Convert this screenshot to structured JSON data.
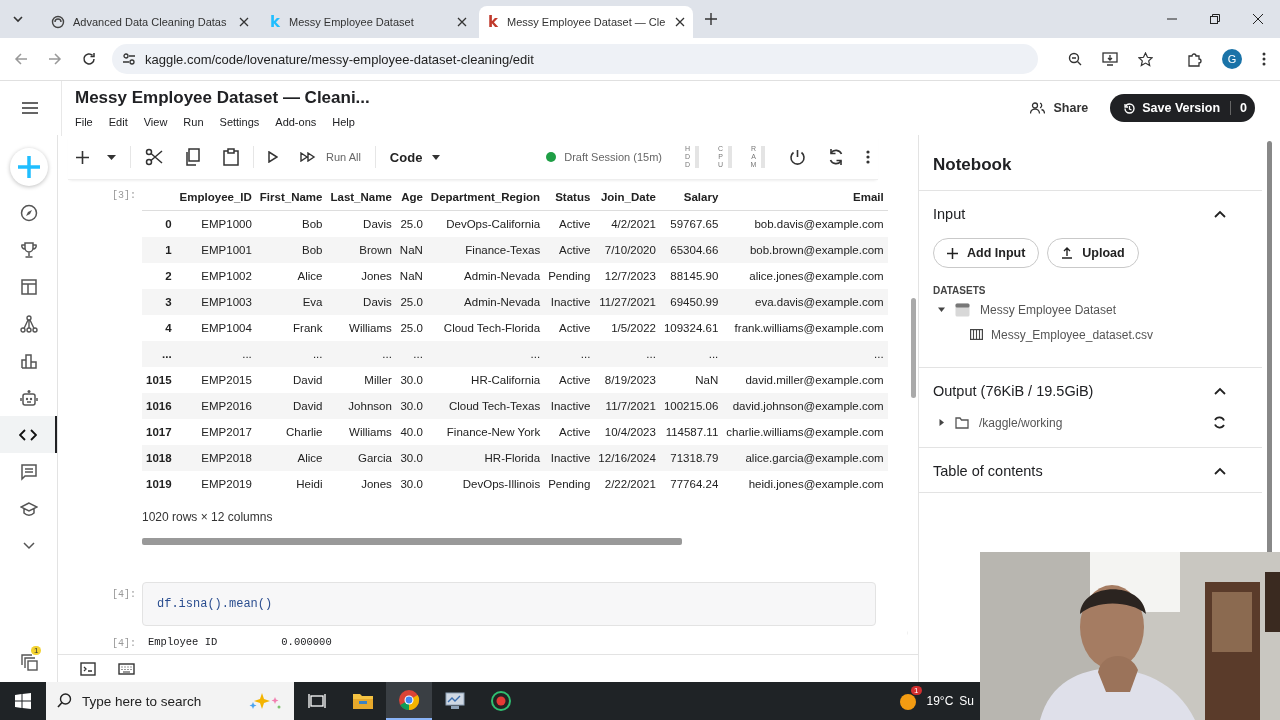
{
  "browser": {
    "tabs": [
      {
        "title": "Advanced Data Cleaning Datas",
        "selected": false
      },
      {
        "title": "Messy Employee Dataset",
        "favicon": "k",
        "selected": false
      },
      {
        "title": "Messy Employee Dataset — Cle",
        "favicon": "k",
        "selected": true
      }
    ],
    "url": "kaggle.com/code/lovenature/messy-employee-dataset-cleaning/edit",
    "profile": "G"
  },
  "kaggle": {
    "title": "Messy Employee Dataset — Cleani...",
    "menu": [
      "File",
      "Edit",
      "View",
      "Run",
      "Settings",
      "Add-ons",
      "Help"
    ],
    "share": "Share",
    "save_version": "Save Version",
    "save_count": "0"
  },
  "rail": [
    {
      "kind": "create",
      "selected": false
    },
    {
      "kind": "compass",
      "selected": false
    },
    {
      "kind": "trophy",
      "selected": false
    },
    {
      "kind": "table",
      "selected": false
    },
    {
      "kind": "network",
      "selected": false
    },
    {
      "kind": "chart",
      "selected": false
    },
    {
      "kind": "robot",
      "selected": false
    },
    {
      "kind": "code",
      "selected": true
    },
    {
      "kind": "comments",
      "selected": false
    },
    {
      "kind": "learn",
      "selected": false
    },
    {
      "kind": "more",
      "selected": false
    }
  ],
  "rail_bottom": {
    "badge": "1"
  },
  "toolbar": {
    "run_all": "Run All",
    "cell_type": "Code",
    "session": "Draft Session (15m)",
    "session_active": true,
    "meters": [
      "HDD",
      "CPU",
      "RAM"
    ]
  },
  "cells": [
    {
      "kind": "dataframe",
      "prompt": "[3]:",
      "columns": [
        "",
        "Employee_ID",
        "First_Name",
        "Last_Name",
        "Age",
        "Department_Region",
        "Status",
        "Join_Date",
        "Salary",
        "Email"
      ],
      "rows": [
        [
          "0",
          "EMP1000",
          "Bob",
          "Davis",
          "25.0",
          "DevOps-California",
          "Active",
          "4/2/2021",
          "59767.65",
          "bob.davis@example.com"
        ],
        [
          "1",
          "EMP1001",
          "Bob",
          "Brown",
          "NaN",
          "Finance-Texas",
          "Active",
          "7/10/2020",
          "65304.66",
          "bob.brown@example.com"
        ],
        [
          "2",
          "EMP1002",
          "Alice",
          "Jones",
          "NaN",
          "Admin-Nevada",
          "Pending",
          "12/7/2023",
          "88145.90",
          "alice.jones@example.com"
        ],
        [
          "3",
          "EMP1003",
          "Eva",
          "Davis",
          "25.0",
          "Admin-Nevada",
          "Inactive",
          "11/27/2021",
          "69450.99",
          "eva.davis@example.com"
        ],
        [
          "4",
          "EMP1004",
          "Frank",
          "Williams",
          "25.0",
          "Cloud Tech-Florida",
          "Active",
          "1/5/2022",
          "109324.61",
          "frank.williams@example.com"
        ],
        [
          "...",
          "...",
          "...",
          "...",
          "...",
          "...",
          "...",
          "...",
          "...",
          "..."
        ],
        [
          "1015",
          "EMP2015",
          "David",
          "Miller",
          "30.0",
          "HR-California",
          "Active",
          "8/19/2023",
          "NaN",
          "david.miller@example.com"
        ],
        [
          "1016",
          "EMP2016",
          "David",
          "Johnson",
          "30.0",
          "Cloud Tech-Texas",
          "Inactive",
          "11/7/2021",
          "100215.06",
          "david.johnson@example.com"
        ],
        [
          "1017",
          "EMP2017",
          "Charlie",
          "Williams",
          "40.0",
          "Finance-New York",
          "Active",
          "10/4/2023",
          "114587.11",
          "charlie.williams@example.com"
        ],
        [
          "1018",
          "EMP2018",
          "Alice",
          "Garcia",
          "30.0",
          "HR-Florida",
          "Inactive",
          "12/16/2024",
          "71318.79",
          "alice.garcia@example.com"
        ],
        [
          "1019",
          "EMP2019",
          "Heidi",
          "Jones",
          "30.0",
          "DevOps-Illinois",
          "Pending",
          "2/22/2021",
          "77764.24",
          "heidi.jones@example.com"
        ]
      ],
      "footer": "1020 rows × 12 columns"
    },
    {
      "kind": "code",
      "prompt": "[4]:",
      "code": "df.isna().mean()",
      "output_prompt": "[4]:",
      "output": [
        [
          "Employee ID",
          "0.000000"
        ]
      ]
    }
  ],
  "panel": {
    "title": "Notebook",
    "sections": [
      {
        "kind": "input",
        "title": "Input",
        "expanded": true,
        "buttons": [
          "Add Input",
          "Upload"
        ],
        "group": "DATASETS",
        "tree": [
          {
            "label": "Messy Employee Dataset",
            "kind": "dataset",
            "expanded": true,
            "children": [
              {
                "label": "Messy_Employee_dataset.csv",
                "kind": "file"
              }
            ]
          }
        ]
      },
      {
        "kind": "output",
        "title": "Output (76KiB / 19.5GiB)",
        "expanded": true,
        "tree": [
          {
            "label": "/kaggle/working",
            "kind": "folder",
            "expanded": false
          }
        ]
      },
      {
        "kind": "toc",
        "title": "Table of contents",
        "expanded": true
      }
    ]
  },
  "taskbar": {
    "search_placeholder": "Type here to search",
    "apps": [
      {
        "kind": "task-view",
        "selected": false
      },
      {
        "kind": "files",
        "selected": false
      },
      {
        "kind": "chrome",
        "selected": true
      },
      {
        "kind": "monitor",
        "selected": false
      },
      {
        "kind": "recorder",
        "selected": false
      }
    ],
    "weather_badge": "1",
    "weather": "19°C",
    "clock": "Su"
  }
}
